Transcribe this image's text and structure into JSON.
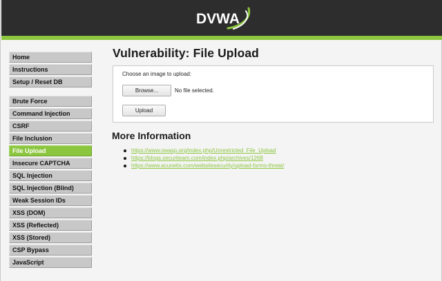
{
  "header": {
    "logo_text": "DVWA"
  },
  "sidebar": {
    "groups": [
      [
        "Home",
        "Instructions",
        "Setup / Reset DB"
      ],
      [
        "Brute Force",
        "Command Injection",
        "CSRF",
        "File Inclusion",
        "File Upload",
        "Insecure CAPTCHA",
        "SQL Injection",
        "SQL Injection (Blind)",
        "Weak Session IDs",
        "XSS (DOM)",
        "XSS (Reflected)",
        "XSS (Stored)",
        "CSP Bypass",
        "JavaScript"
      ]
    ],
    "selected": "File Upload"
  },
  "main": {
    "title": "Vulnerability: File Upload",
    "upload_label": "Choose an image to upload:",
    "browse_label": "Browse...",
    "file_status": "No file selected.",
    "upload_button": "Upload",
    "more_info_title": "More Information",
    "links": [
      "https://www.owasp.org/index.php/Unrestricted_File_Upload",
      "https://blogs.securiteam.com/index.php/archives/1268",
      "https://www.acunetix.com/websitesecurity/upload-forms-threat/"
    ]
  },
  "colors": {
    "accent_green": "#8cc63f",
    "header_bg": "#2d2d2d",
    "menu_bg": "#c8c8c8",
    "page_bg": "#f4f4f4"
  }
}
